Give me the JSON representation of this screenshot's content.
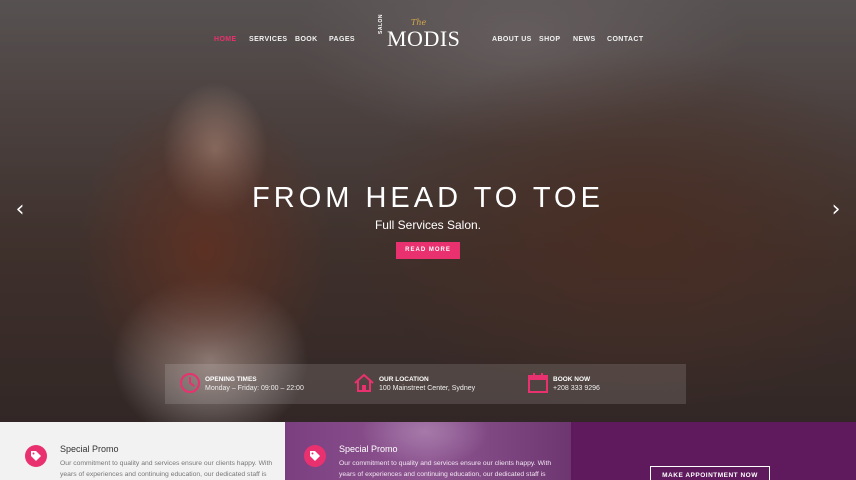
{
  "nav": {
    "left": [
      "HOME",
      "SERVICES",
      "BOOK",
      "PAGES"
    ],
    "right": [
      "ABOUT US",
      "SHOP",
      "NEWS",
      "CONTACT"
    ],
    "active": "HOME"
  },
  "logo": {
    "the": "The",
    "salon": "SALON",
    "name": "MODIS"
  },
  "hero": {
    "title": "FROM HEAD TO TOE",
    "subtitle": "Full Services Salon.",
    "button": "READ MORE",
    "prev_icon": "chevron-left-icon",
    "next_icon": "chevron-right-icon"
  },
  "info": [
    {
      "title": "OPENING TIMES",
      "value": "Monday – Friday: 09:00 – 22:00",
      "icon": "clock-icon"
    },
    {
      "title": "OUR LOCATION",
      "value": "100 Mainstreet Center, Sydney",
      "icon": "home-icon"
    },
    {
      "title": "BOOK NOW",
      "value": "+208 333 9296",
      "icon": "calendar-icon"
    }
  ],
  "promos": [
    {
      "title": "Special Promo",
      "text": "Our commitment to quality and services ensure our clients happy. With years of experiences and continuing education, our dedicated staff is",
      "icon": "tag-icon"
    },
    {
      "title": "Special Promo",
      "text": "Our commitment to quality and services ensure our clients happy. With years of experiences and continuing education, our dedicated staff is",
      "icon": "tag-icon"
    }
  ],
  "appointment_button": "MAKE APPOINTMENT NOW",
  "colors": {
    "accent": "#e8316e",
    "purple": "#5e1a5c",
    "gold": "#d7a94b"
  }
}
